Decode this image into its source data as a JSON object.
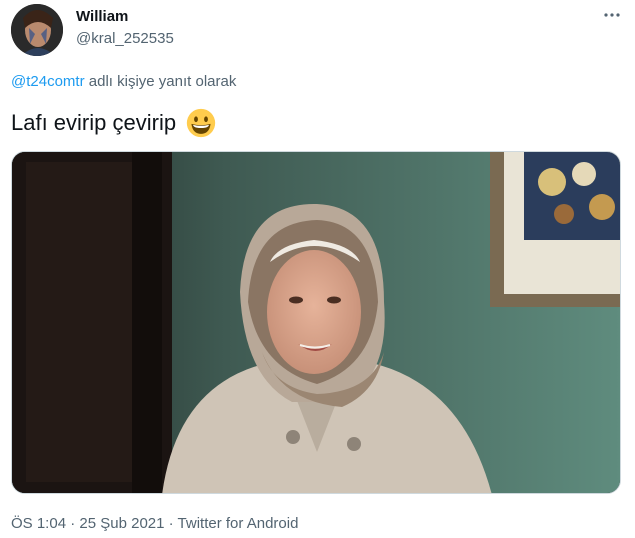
{
  "user": {
    "name": "William",
    "handle": "@kral_252535"
  },
  "replying": {
    "mention": "@t24comtr",
    "suffix": " adlı kişiye yanıt olarak"
  },
  "tweet": {
    "text": "Lafı evirip çevirip",
    "emoji": "grinning-face-emoji"
  },
  "media": {
    "type": "photo",
    "description_icon": "video-still-icon"
  },
  "meta": {
    "time": "ÖS 1:04",
    "separator": " · ",
    "date": "25 Şub 2021",
    "source": "Twitter for Android"
  },
  "colors": {
    "text": "#0f1419",
    "secondary": "#536471",
    "accent": "#1d9bf0"
  }
}
